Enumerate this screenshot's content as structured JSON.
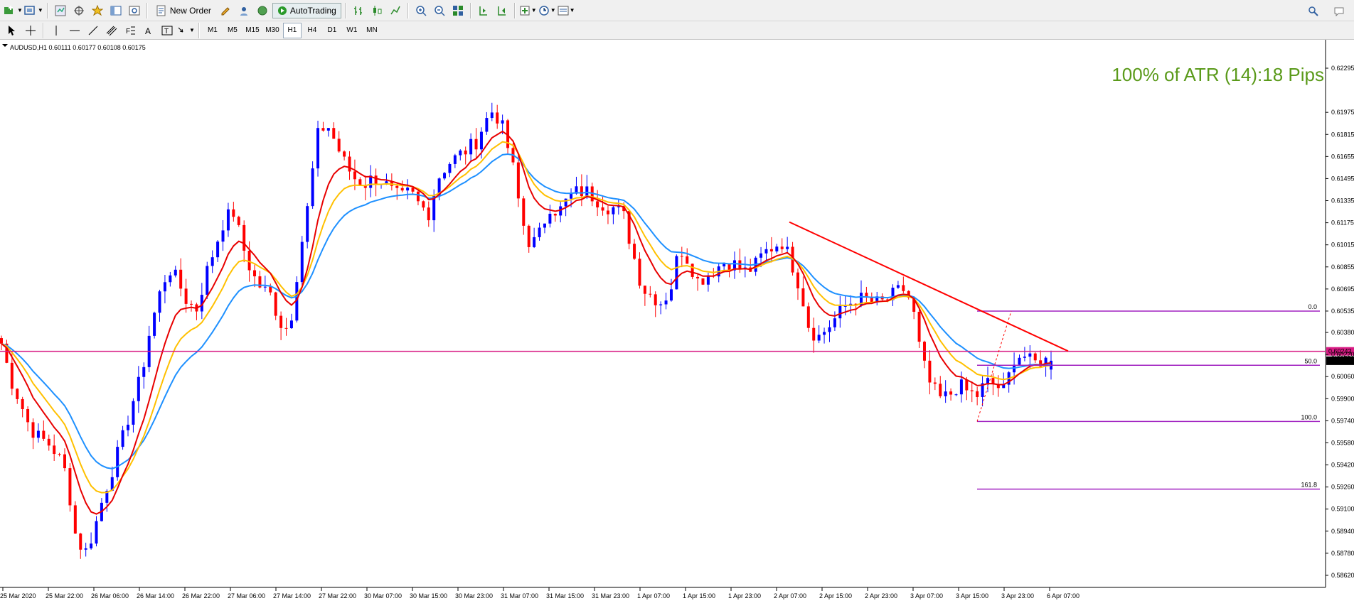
{
  "toolbar": {
    "new_order_label": "New Order",
    "autotrading_label": "AutoTrading",
    "timeframes": [
      "M1",
      "M5",
      "M15",
      "M30",
      "H1",
      "H4",
      "D1",
      "W1",
      "MN"
    ],
    "active_timeframe": "H1"
  },
  "chart": {
    "symbol_line": "AUDUSD,H1  0.60111 0.60177 0.60108 0.60175",
    "atr_text": "100% of ATR (14):18 Pips",
    "horizontal_price_label": "0.60243",
    "current_price_label": "0.60175",
    "colors": {
      "bull": "#0000ff",
      "bear": "#ff0000",
      "ema_fast": "#e80000",
      "ema_mid": "#ffc000",
      "ema_slow": "#1e90ff",
      "hline": "#d81b84",
      "fib": "#a020c0",
      "trendline": "#ff0000",
      "atr_text": "#5a9a1a"
    },
    "fib_levels": [
      {
        "label": "0.0",
        "price": 0.60535
      },
      {
        "label": "50.0",
        "price": 0.60142
      },
      {
        "label": "100.0",
        "price": 0.59735
      },
      {
        "label": "161.8",
        "price": 0.59245
      }
    ],
    "horizontal_line_price": 0.60243,
    "trendline": {
      "from": {
        "time": "2 Apr 07:00",
        "price": 0.6118
      },
      "to": {
        "time": "6 Apr 07:00",
        "price": 0.60245
      }
    },
    "price_axis": [
      "0.62295",
      "0.61975",
      "0.61815",
      "0.61655",
      "0.61495",
      "0.61335",
      "0.61175",
      "0.61015",
      "0.60855",
      "0.60695",
      "0.60535",
      "0.60380",
      "0.60220",
      "0.60060",
      "0.59900",
      "0.59740",
      "0.59580",
      "0.59420",
      "0.59260",
      "0.59100",
      "0.58940",
      "0.58780",
      "0.58620"
    ],
    "time_axis": [
      "25 Mar 2020",
      "25 Mar 22:00",
      "26 Mar 06:00",
      "26 Mar 14:00",
      "26 Mar 22:00",
      "27 Mar 06:00",
      "27 Mar 14:00",
      "27 Mar 22:00",
      "30 Mar 07:00",
      "30 Mar 15:00",
      "30 Mar 23:00",
      "31 Mar 07:00",
      "31 Mar 15:00",
      "31 Mar 23:00",
      "1 Apr 07:00",
      "1 Apr 15:00",
      "1 Apr 23:00",
      "2 Apr 07:00",
      "2 Apr 15:00",
      "2 Apr 23:00",
      "3 Apr 07:00",
      "3 Apr 15:00",
      "3 Apr 23:00",
      "6 Apr 07:00"
    ],
    "price_path": [
      0.603,
      0.6004,
      0.5988,
      0.597,
      0.5962,
      0.5958,
      0.595,
      0.5935,
      0.589,
      0.5878,
      0.5895,
      0.592,
      0.594,
      0.596,
      0.5985,
      0.6005,
      0.604,
      0.6065,
      0.6085,
      0.6075,
      0.606,
      0.6055,
      0.608,
      0.61,
      0.612,
      0.6125,
      0.61,
      0.608,
      0.607,
      0.6065,
      0.6045,
      0.604,
      0.609,
      0.613,
      0.618,
      0.619,
      0.6175,
      0.616,
      0.615,
      0.6145,
      0.615,
      0.6148,
      0.614,
      0.6135,
      0.614,
      0.613,
      0.6125,
      0.615,
      0.616,
      0.6165,
      0.617,
      0.6175,
      0.619,
      0.62,
      0.6185,
      0.616,
      0.612,
      0.61,
      0.611,
      0.613,
      0.6125,
      0.6135,
      0.614,
      0.614,
      0.6135,
      0.613,
      0.6128,
      0.6122,
      0.6095,
      0.607,
      0.6065,
      0.606,
      0.6068,
      0.61,
      0.609,
      0.6075,
      0.608,
      0.6085,
      0.609,
      0.6087,
      0.6082,
      0.6085,
      0.6095,
      0.61,
      0.6104,
      0.609,
      0.607,
      0.604,
      0.6035,
      0.6042,
      0.605,
      0.6058,
      0.6062,
      0.6062,
      0.6059,
      0.606,
      0.6065,
      0.607,
      0.606,
      0.602,
      0.6,
      0.599,
      0.5992,
      0.6,
      0.5995,
      0.5992,
      0.6002,
      0.6,
      0.5995,
      0.602,
      0.6022,
      0.6015,
      0.6018,
      0.6017
    ]
  }
}
